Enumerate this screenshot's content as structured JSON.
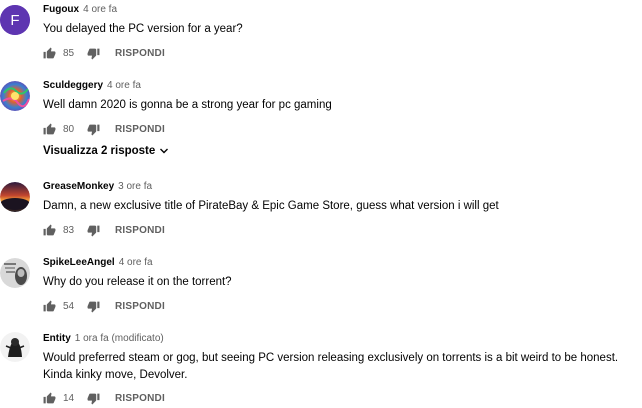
{
  "comments": [
    {
      "author": "Fugoux",
      "time": "4 ore fa",
      "text": "You delayed the PC version for a year?",
      "likes": "85",
      "reply_label": "RISPONDI",
      "avatar": {
        "type": "letter",
        "letter": "F",
        "color": "#5e35b1"
      }
    },
    {
      "author": "Sculdeggery",
      "time": "4 ore fa",
      "text": "Well damn 2020 is gonna be a strong year for pc gaming",
      "likes": "80",
      "reply_label": "RISPONDI",
      "view_replies": "Visualizza 2 risposte",
      "avatar": {
        "type": "image",
        "description": "colorful-psychedelic"
      }
    },
    {
      "author": "GreaseMonkey",
      "time": "3 ore fa",
      "text": "Damn, a new exclusive title of PirateBay & Epic Game Store, guess what version i will get",
      "likes": "83",
      "reply_label": "RISPONDI",
      "avatar": {
        "type": "image",
        "description": "sunset-planet"
      }
    },
    {
      "author": "SpikeLeeAngel",
      "time": "4 ore fa",
      "text": "Why do you release it on the torrent?",
      "likes": "54",
      "reply_label": "RISPONDI",
      "avatar": {
        "type": "image",
        "description": "grayscale-portrait"
      }
    },
    {
      "author": "Entity",
      "time": "1 ora fa (modificato)",
      "text": "Would preferred steam or gog, but seeing PC version releasing exclusively on torrents is a bit weird to be honest. Kinda kinky move, Devolver.",
      "likes": "14",
      "reply_label": "RISPONDI",
      "avatar": {
        "type": "image",
        "description": "black-white-figure"
      }
    }
  ],
  "icons": {
    "like": "thumbs-up-icon",
    "dislike": "thumbs-down-icon",
    "expand": "chevron-down-icon"
  },
  "colors": {
    "author": "#030303",
    "meta": "#606060",
    "avatar_f": "#5e35b1"
  }
}
